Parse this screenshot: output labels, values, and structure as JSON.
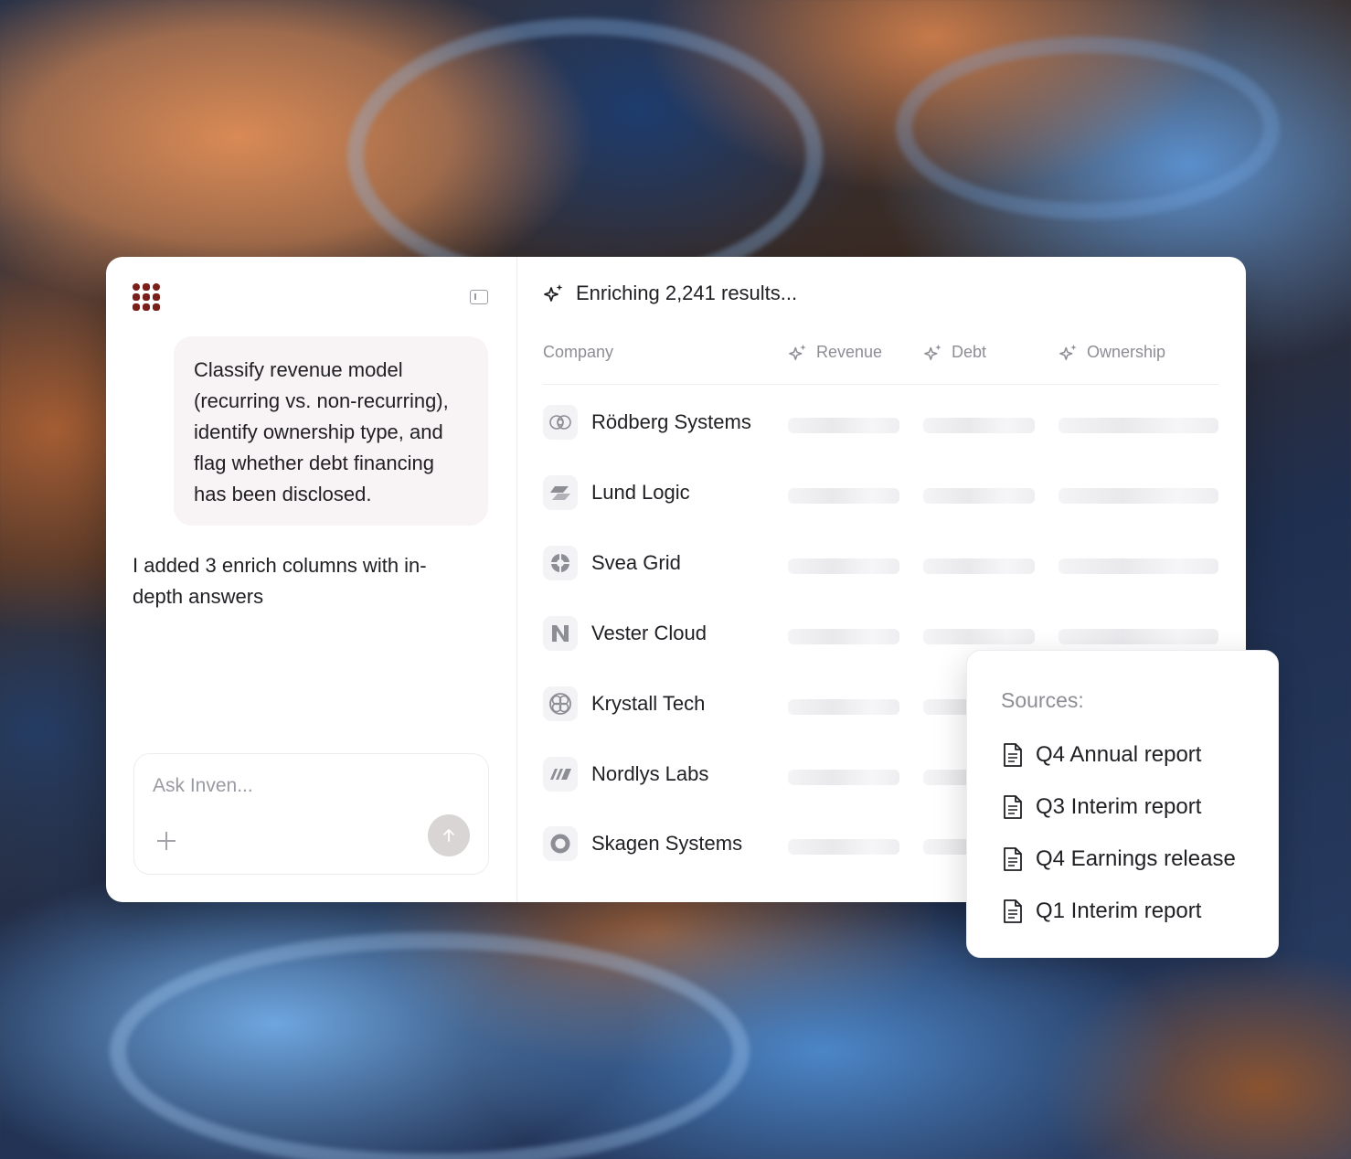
{
  "chat": {
    "user_message": "Classify revenue model\n(recurring vs. non-recurring),\nidentify ownership type, and\nflag whether debt financing\nhas been disclosed.",
    "assistant_message": "I added 3 enrich columns with in-\ndepth answers",
    "composer_placeholder": "Ask Inven..."
  },
  "results": {
    "status": "Enriching 2,241 results...",
    "columns": [
      "Company",
      "Revenue",
      "Debt",
      "Ownership"
    ],
    "companies": [
      {
        "name": "Rödberg Systems",
        "icon": "interlocking-circles-icon"
      },
      {
        "name": "Lund Logic",
        "icon": "slanted-blocks-icon"
      },
      {
        "name": "Svea Grid",
        "icon": "quadrant-circle-icon"
      },
      {
        "name": "Vester Cloud",
        "icon": "n-shape-icon"
      },
      {
        "name": "Krystall Tech",
        "icon": "knot-circle-icon"
      },
      {
        "name": "Nordlys Labs",
        "icon": "parallel-stripes-icon"
      },
      {
        "name": "Skagen Systems",
        "icon": "ring-icon"
      }
    ]
  },
  "sources": {
    "title": "Sources:",
    "items": [
      "Q4 Annual report",
      "Q3 Interim report",
      "Q4 Earnings release",
      "Q1 Interim report"
    ]
  },
  "colors": {
    "brand": "#7a1f1a",
    "user_bubble": "#f8f3f4",
    "muted_text": "#8d8d95"
  }
}
